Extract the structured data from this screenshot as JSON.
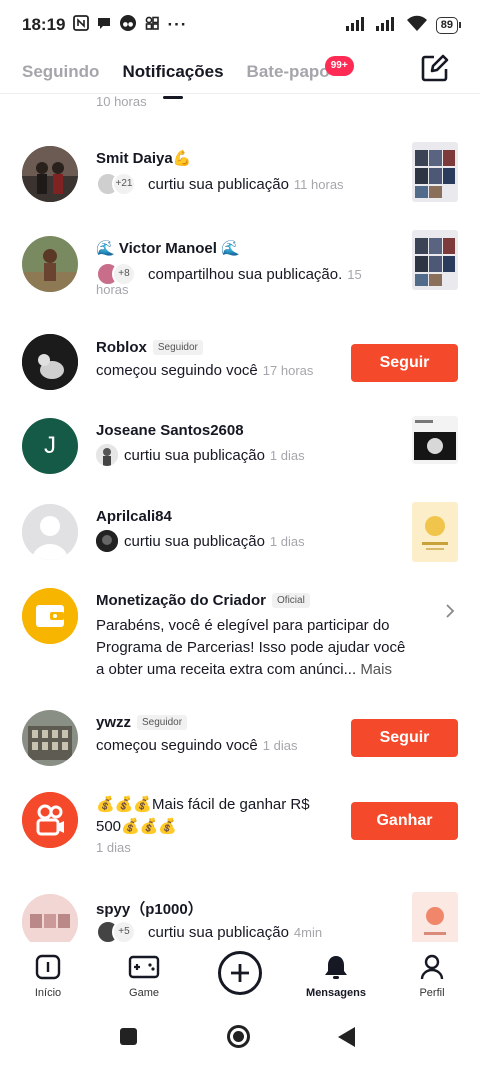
{
  "status_bar": {
    "time": "18:19",
    "battery": "89"
  },
  "tabs": [
    {
      "label": "Seguindo",
      "active": false
    },
    {
      "label": "Notificações",
      "active": true
    },
    {
      "label": "Bate-papo",
      "active": false,
      "badge": "99+"
    }
  ],
  "list": {
    "top_time": "10 horas",
    "items": [
      {
        "name": "Smit Daiya💪",
        "count": "+21",
        "action": "curtiu sua publicação",
        "time": "11 horas"
      },
      {
        "name": "🌊 Victor Manoel 🌊",
        "count": "+8",
        "action": "compartilhou sua publicação.",
        "time": "15",
        "time_cont": "horas"
      },
      {
        "name": "Roblox",
        "tag": "Seguidor",
        "action": "começou seguindo você",
        "time": "17 horas",
        "button": "Seguir"
      },
      {
        "name": "Joseane Santos2608",
        "avatar_letter": "J",
        "action": "curtiu sua publicação",
        "time": "1 dias"
      },
      {
        "name": "Aprilcali84",
        "action": "curtiu sua publicação",
        "time": "1 dias"
      },
      {
        "name": "Monetização do Criador",
        "tag": "Oficial",
        "message": "Parabéns, você é elegível para participar do Programa de Parcerias! Isso pode ajudar você a obter uma receita extra com anúnci...",
        "more": "Mais"
      },
      {
        "name": "ywzz",
        "tag": "Seguidor",
        "action": "começou seguindo você",
        "time": "1 dias",
        "button": "Seguir"
      },
      {
        "message": "💰💰💰Mais fácil de ganhar R$ 500💰💰💰",
        "time": "1 dias",
        "button": "Ganhar"
      },
      {
        "name": "spyy（p1000）",
        "count": "+5",
        "action": "curtiu sua publicação",
        "time": "4min"
      }
    ]
  },
  "nav": [
    {
      "label": "Início",
      "icon": "home-icon"
    },
    {
      "label": "Game",
      "icon": "gamepad-icon"
    },
    {
      "label": "",
      "icon": "plus-icon"
    },
    {
      "label": "Mensagens",
      "icon": "bell-icon",
      "active": true
    },
    {
      "label": "Perfil",
      "icon": "person-icon"
    }
  ],
  "colors": {
    "accent": "#f4492b",
    "badge": "#fe2c55",
    "wallet": "#f7b500",
    "kwai": "#f4492b",
    "joseane": "#145a46"
  }
}
